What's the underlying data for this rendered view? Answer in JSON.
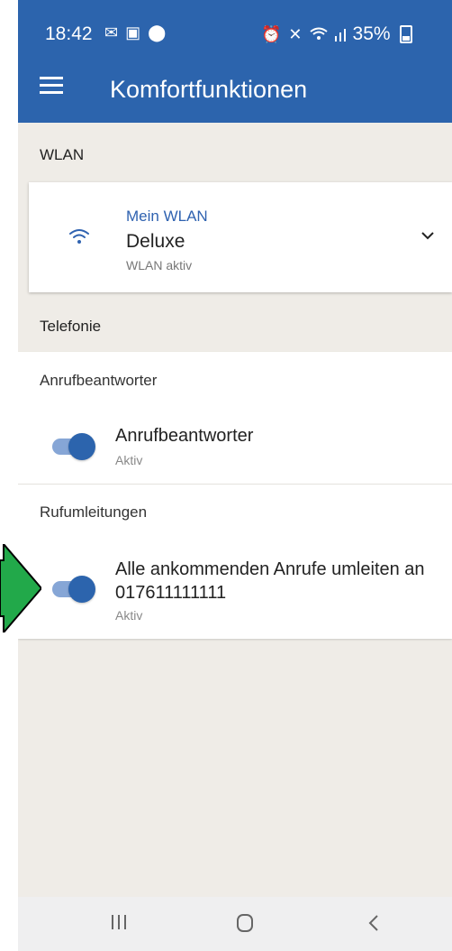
{
  "status_bar": {
    "time": "18:42",
    "battery": "35%",
    "left_icons": [
      "notification-icon",
      "image-icon",
      "location-icon"
    ],
    "right_icons": [
      "alarm-icon",
      "mute-icon",
      "wifi-icon",
      "signal-icon",
      "battery-icon"
    ]
  },
  "app_bar": {
    "title": "Komfortfunktionen",
    "menu_icon": "menu-icon",
    "color": "#2c64ad"
  },
  "wlan_section": {
    "header": "WLAN",
    "card": {
      "subtitle": "Mein WLAN",
      "name": "Deluxe",
      "status": "WLAN aktiv",
      "icon": "wifi-icon",
      "chevron": "chevron-down-icon"
    }
  },
  "telefonie_section": {
    "header": "Telefonie",
    "anrufbeantworter": {
      "group_label": "Anrufbeantworter",
      "item": {
        "title": "Anrufbeantworter",
        "status": "Aktiv",
        "toggle_on": true
      }
    },
    "rufumleitungen": {
      "group_label": "Rufumleitungen",
      "item": {
        "title": "Alle ankommenden Anrufe umleiten an 017611111111",
        "status": "Aktiv",
        "toggle_on": true
      }
    }
  },
  "nav_bar": {
    "recent_icon": "recent-apps-icon",
    "home_icon": "home-icon",
    "back_icon": "back-icon"
  },
  "colors": {
    "accent": "#2c64ad",
    "toggle_track": "#86a6d6",
    "background": "#efece7",
    "marker": "#22a94a"
  }
}
